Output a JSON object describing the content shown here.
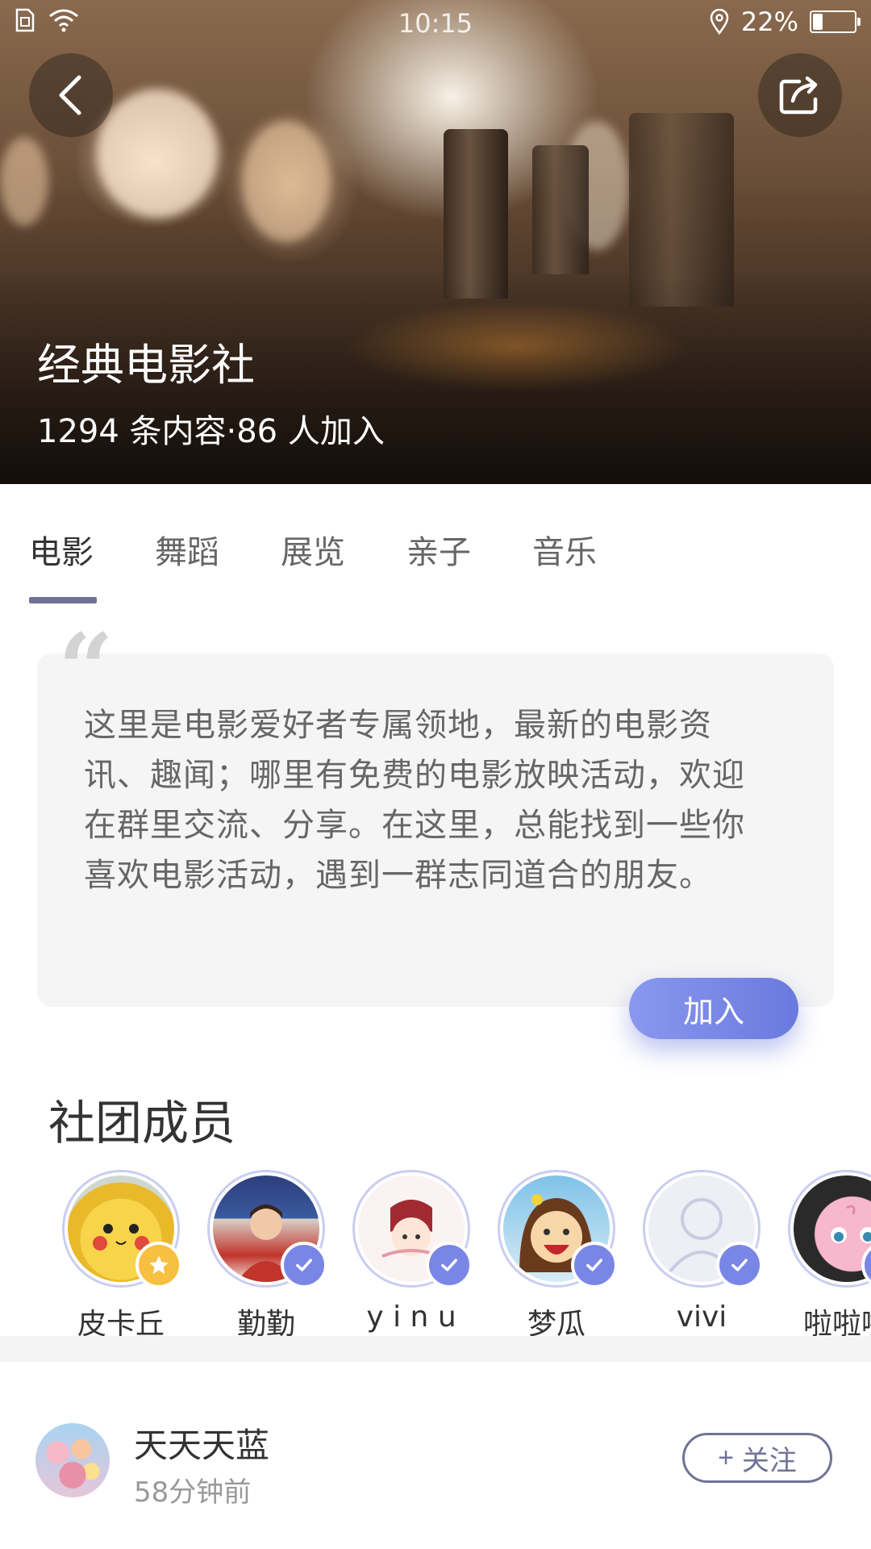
{
  "status_bar": {
    "time": "10:15",
    "battery_percent": "22%",
    "battery_level": 0.22
  },
  "hero": {
    "title": "经典电影社",
    "stats": "1294 条内容·86 人加入",
    "back_icon": "chevron-left-icon",
    "share_icon": "share-icon"
  },
  "tabs": [
    {
      "label": "电影",
      "active": true
    },
    {
      "label": "舞蹈",
      "active": false
    },
    {
      "label": "展览",
      "active": false
    },
    {
      "label": "亲子",
      "active": false
    },
    {
      "label": "音乐",
      "active": false
    }
  ],
  "description": {
    "text": "这里是电影爱好者专属领地，最新的电影资讯、趣闻；哪里有免费的电影放映活动，欢迎在群里交流、分享。在这里，总能找到一些你喜欢电影活动，遇到一群志同道合的朋友。",
    "join_label": "加入"
  },
  "members": {
    "title": "社团成员",
    "list": [
      {
        "name": "皮卡丘",
        "badge": "star"
      },
      {
        "name": "勤勤",
        "badge": "check"
      },
      {
        "name": "y i n u",
        "badge": "check"
      },
      {
        "name": "梦瓜",
        "badge": "check"
      },
      {
        "name": "vivi",
        "badge": "check"
      },
      {
        "name": "啦啦啦",
        "badge": "check"
      }
    ]
  },
  "post": {
    "user": "天天天蓝",
    "time": "58分钟前",
    "follow_label": "关注",
    "follow_prefix": "+"
  },
  "colors": {
    "accent": "#6f7396",
    "join_gradient_start": "#8a98ef",
    "join_gradient_end": "#6a79de",
    "badge_check": "#7a86e6",
    "badge_star": "#f7c040"
  }
}
